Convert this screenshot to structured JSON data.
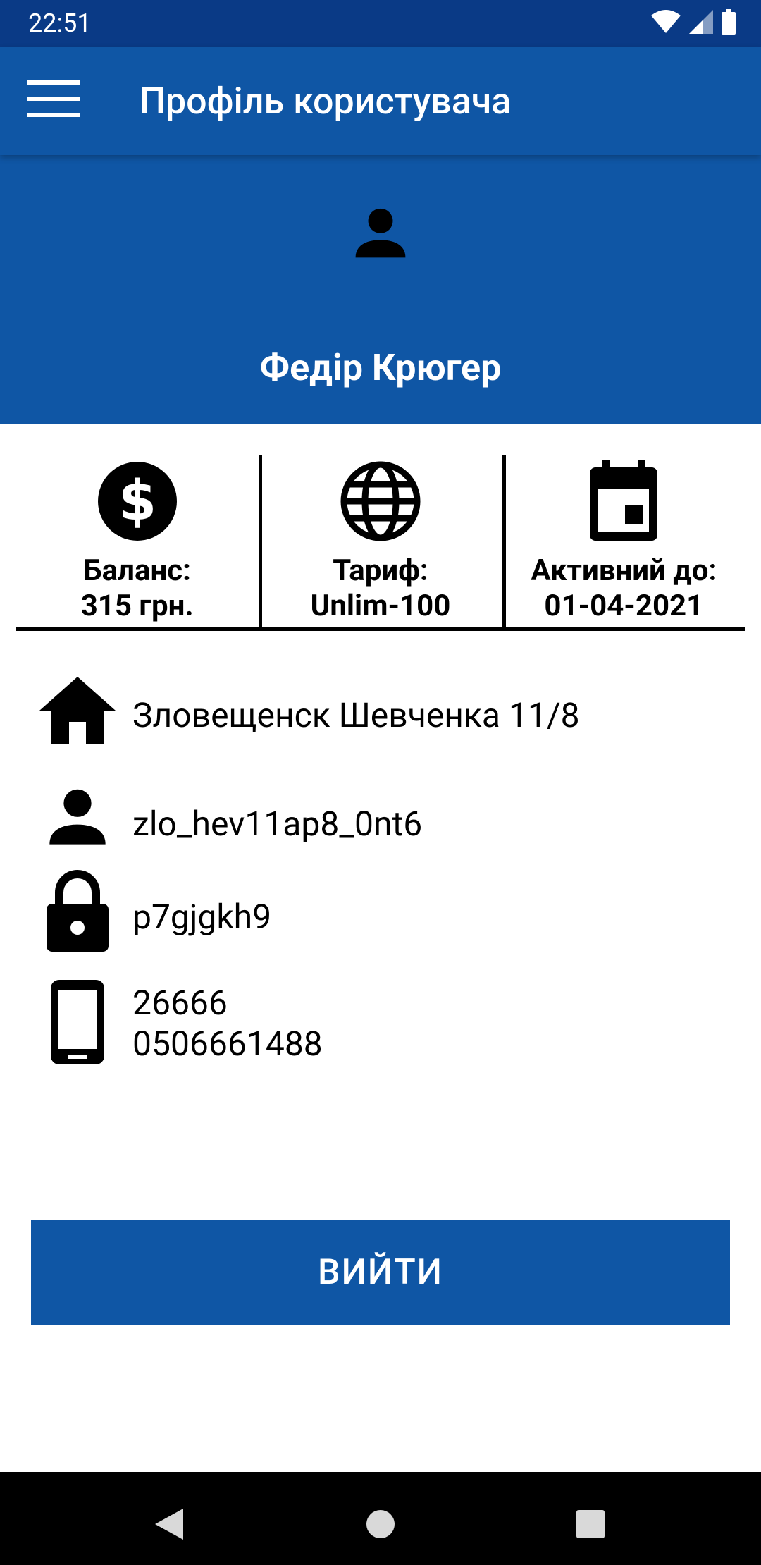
{
  "status_bar": {
    "time": "22:51",
    "icons": [
      "wifi-icon",
      "cell-signal-icon",
      "battery-icon"
    ]
  },
  "app_bar": {
    "menu_icon": "menu-icon",
    "title": "Профіль користувача"
  },
  "profile": {
    "avatar_icon": "person-icon",
    "name": "Федір Крюгер"
  },
  "stats": [
    {
      "icon": "dollar-icon",
      "label": "Баланс:",
      "value": "315 грн."
    },
    {
      "icon": "globe-icon",
      "label": "Тариф:",
      "value": "Unlim-100"
    },
    {
      "icon": "calendar-icon",
      "label": "Активний до:",
      "value": "01-04-2021"
    }
  ],
  "info": {
    "address": {
      "icon": "home-icon",
      "text": "Зловещенск Шевченка 11/8"
    },
    "login": {
      "icon": "person-icon",
      "text": "zlo_hev11ap8_0nt6"
    },
    "password": {
      "icon": "lock-icon",
      "text": "p7gjgkh9"
    },
    "phones": {
      "icon": "phone-icon",
      "line1": "26666",
      "line2": "0506661488"
    }
  },
  "logout_button": {
    "label": "ВИЙТИ"
  },
  "nav_bar": {
    "back": "back-icon",
    "home": "home-circle-icon",
    "recents": "recents-icon"
  },
  "colors": {
    "status_bar_bg": "#0a3a86",
    "primary": "#0f56a5",
    "text_on_primary": "#ffffff",
    "nav_bar_bg": "#000000"
  }
}
